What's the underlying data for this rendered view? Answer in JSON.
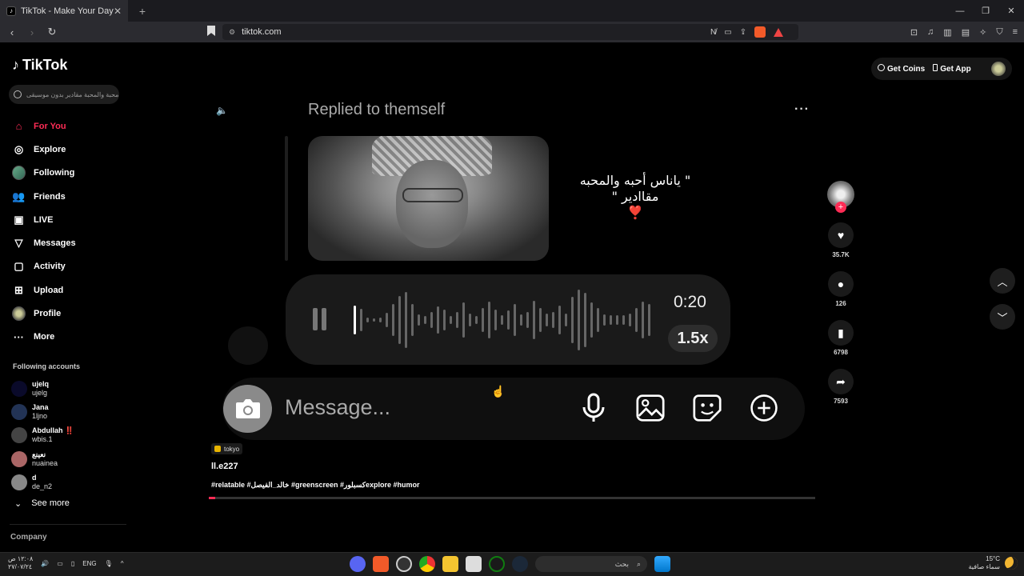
{
  "browser": {
    "tab_title": "TikTok - Make Your Day",
    "url": "tiktok.com",
    "new_tab": "+",
    "close": "✕"
  },
  "sidebar": {
    "logo_text": "TikTok",
    "search_placeholder": "محبة والمحبة مقادير بدون موسيقى...",
    "menu": [
      {
        "label": "For You",
        "icon": "home-icon"
      },
      {
        "label": "Explore",
        "icon": "compass-icon"
      },
      {
        "label": "Following",
        "icon": "avatar-icon"
      },
      {
        "label": "Friends",
        "icon": "people-icon"
      },
      {
        "label": "LIVE",
        "icon": "live-icon"
      },
      {
        "label": "Messages",
        "icon": "send-icon"
      },
      {
        "label": "Activity",
        "icon": "activity-icon"
      },
      {
        "label": "Upload",
        "icon": "plus-square-icon"
      },
      {
        "label": "Profile",
        "icon": "profile-avatar-icon"
      },
      {
        "label": "More",
        "icon": "dots-icon"
      }
    ],
    "following_title": "Following accounts",
    "accounts": [
      {
        "name": "ujelq",
        "user": "ujelg"
      },
      {
        "name": "Jana",
        "user": "1ljno"
      },
      {
        "name": "Abdullah ‼️",
        "user": "wbis.1"
      },
      {
        "name": "نعينع",
        "user": "nuainea"
      },
      {
        "name": "d",
        "user": "de_n2"
      }
    ],
    "see_more": "See more",
    "company": "Company"
  },
  "topbar": {
    "get_coins": "Get Coins",
    "get_app": "Get App"
  },
  "video": {
    "replied_text": "Replied to themself",
    "caption_line1": "\" ياناس أحبه والمحبه",
    "caption_line2": "مقاادير \"",
    "caption_heart": "❣️",
    "voice_time": "0:20",
    "voice_speed": "1.5x",
    "message_placeholder": "Message...",
    "location_tag": "tokyo",
    "author": "ll.e227",
    "hashtags": "#relatable #خالد_الفيصل #greenscreen #كسبلورexplore #humor",
    "progress": 0.01
  },
  "actions": {
    "likes": "35.7K",
    "comments": "126",
    "saves": "6798",
    "shares": "7593"
  },
  "taskbar": {
    "time": "١٢:٠٨ ص",
    "date": "٢٧/٠٧/٢٤",
    "lang": "ENG",
    "search_text": "بحث",
    "temperature": "15°C",
    "weather": "سماء صافية"
  },
  "colors": {
    "accent": "#fe2c55",
    "background": "#000000"
  }
}
